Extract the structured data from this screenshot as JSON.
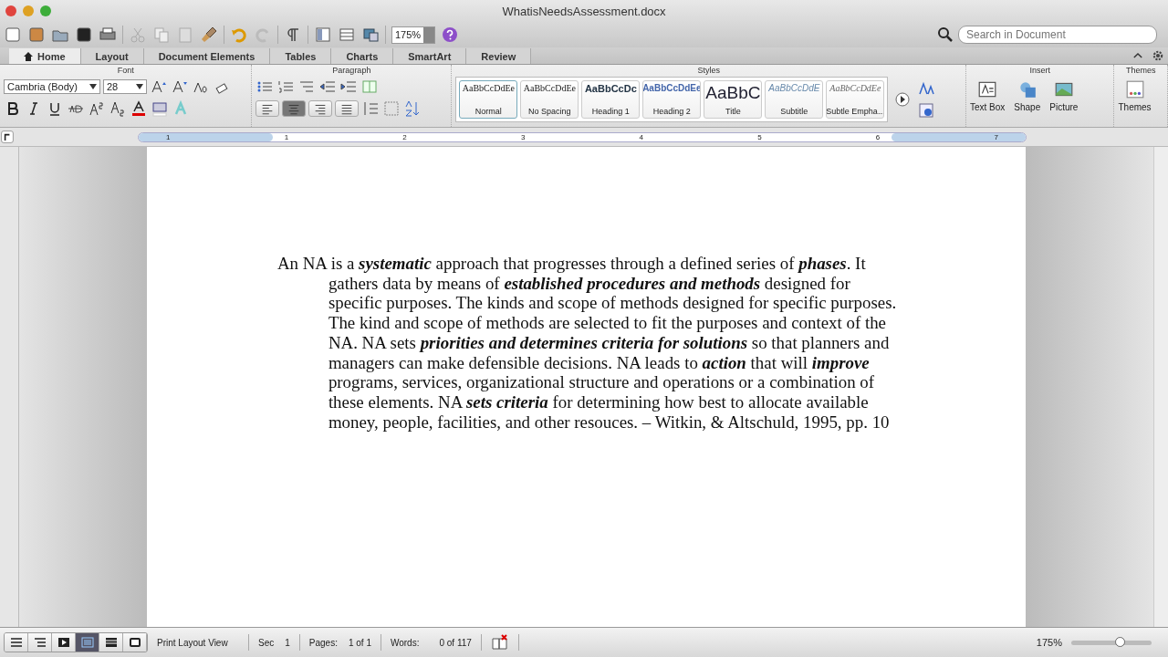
{
  "window": {
    "title": "WhatisNeedsAssessment.docx"
  },
  "toolbar": {
    "zoom": "175%"
  },
  "search": {
    "placeholder": "Search in Document"
  },
  "tabs": [
    {
      "label": "Home",
      "selected": true
    },
    {
      "label": "Layout",
      "selected": false
    },
    {
      "label": "Document Elements",
      "selected": false
    },
    {
      "label": "Tables",
      "selected": false
    },
    {
      "label": "Charts",
      "selected": false
    },
    {
      "label": "SmartArt",
      "selected": false
    },
    {
      "label": "Review",
      "selected": false
    }
  ],
  "ribbon": {
    "font": {
      "title": "Font",
      "font_name": "Cambria (Body)",
      "font_size": "28"
    },
    "paragraph": {
      "title": "Paragraph",
      "alignment": [
        {
          "kind": "left",
          "selected": false
        },
        {
          "kind": "center",
          "selected": true
        },
        {
          "kind": "right",
          "selected": false
        },
        {
          "kind": "justify",
          "selected": false
        }
      ]
    },
    "styles": {
      "title": "Styles",
      "items": [
        {
          "kind": "normal",
          "sample": "AaBbCcDdEe",
          "label": "Normal",
          "selected": true
        },
        {
          "kind": "plain",
          "sample": "AaBbCcDdEe",
          "label": "No Spacing",
          "selected": false
        },
        {
          "kind": "heading1",
          "sample": "AaBbCcDc",
          "label": "Heading 1",
          "selected": false
        },
        {
          "kind": "heading2",
          "sample": "AaBbCcDdEe",
          "label": "Heading 2",
          "selected": false
        },
        {
          "kind": "title",
          "sample": "AaBbC",
          "label": "Title",
          "selected": false
        },
        {
          "kind": "subtitle",
          "sample": "AaBbCcDdE",
          "label": "Subtitle",
          "selected": false
        },
        {
          "kind": "emphasis",
          "sample": "AaBbCcDdEe",
          "label": "Subtle Empha...",
          "selected": false
        }
      ]
    },
    "insert": {
      "title": "Insert",
      "items": [
        {
          "kind": "textbox",
          "label": "Text Box"
        },
        {
          "kind": "shape",
          "label": "Shape"
        },
        {
          "kind": "picture",
          "label": "Picture"
        }
      ]
    },
    "themes": {
      "title": "Themes",
      "label": "Themes"
    }
  },
  "ruler": {
    "marks": [
      "1",
      "1",
      "2",
      "3",
      "4",
      "5",
      "6",
      "7"
    ]
  },
  "document": {
    "paragraph": "An NA is a **systematic** approach that progresses through a defined series of **phases**. It gathers data by means of **established procedures and methods** designed for specific purposes. The kinds and scope of methods designed for specific purposes. The kind and scope of methods are selected to fit the purposes and context of the NA. NA sets **priorities and determines criteria for solutions** so that planners and managers can make defensible decisions. NA leads to **action** that will **improve** programs, services, organizational structure and operations or a combination of these elements. NA **sets criteria** for determining how best to allocate available money, people, facilities, and other resouces. – Witkin, & Altschuld, 1995, pp. 10"
  },
  "status_bar": {
    "views": [
      {
        "kind": "draft",
        "selected": false
      },
      {
        "kind": "outline",
        "selected": false
      },
      {
        "kind": "publishing",
        "selected": false
      },
      {
        "kind": "print",
        "selected": true
      },
      {
        "kind": "notebook",
        "selected": false
      },
      {
        "kind": "focus",
        "selected": false
      }
    ],
    "view_name": "Print Layout View",
    "sec_label": "Sec",
    "sec": "1",
    "pages_label": "Pages:",
    "pages": "1 of 1",
    "words_label": "Words:",
    "words": "0 of 117",
    "zoom": "175%",
    "zoom_slider": {
      "level": 0.6
    }
  }
}
